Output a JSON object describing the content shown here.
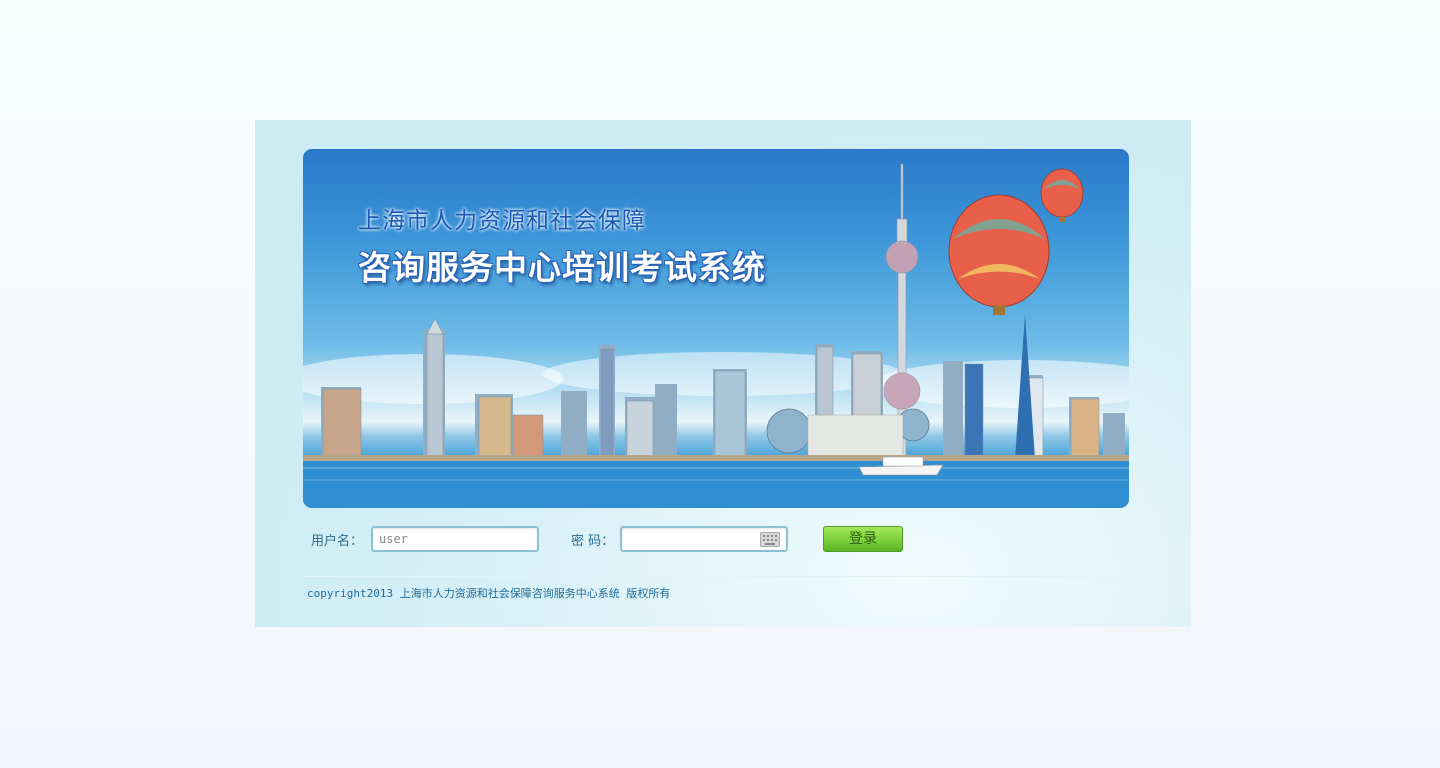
{
  "banner": {
    "title_line1": "上海市人力资源和社会保障",
    "title_line2": "咨询服务中心培训考试系统"
  },
  "form": {
    "username_label": "用户名：",
    "username_value": "user",
    "password_label": "密 码：",
    "password_value": "",
    "login_label": "登录"
  },
  "footer": {
    "copyright": "copyright2013 上海市人力资源和社会保障咨询服务中心系统 版权所有"
  },
  "colors": {
    "accent_green": "#7fd23d",
    "title_blue": "#1a59b4",
    "label_teal": "#2c6a8a"
  }
}
